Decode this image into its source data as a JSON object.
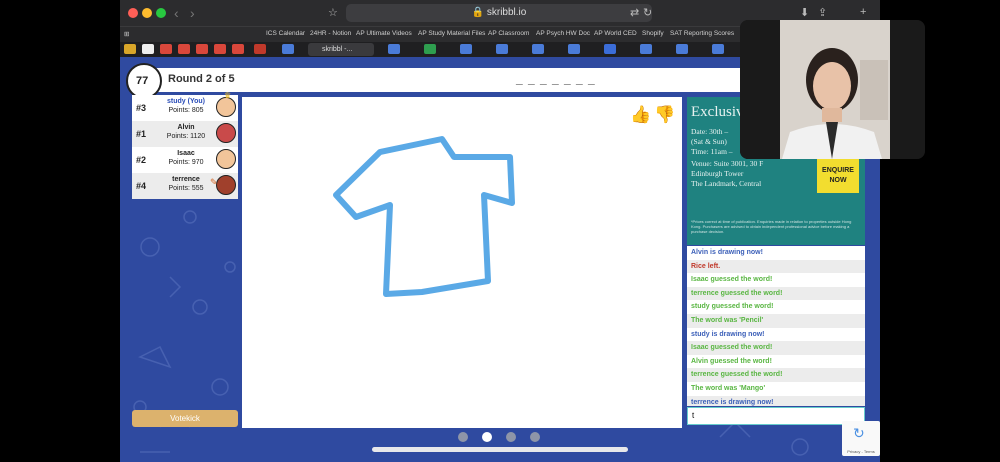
{
  "browser": {
    "url": "skribbl.io",
    "bookmarks": [
      "ICS Calendar",
      "24HR - Notion",
      "AP Ultimate Videos",
      "AP Study Material Files",
      "AP Classroom",
      "AP Psych HW Doc",
      "AP World CED",
      "Shopify",
      "SAT Reporting Scores"
    ],
    "active_tab": "skribbl -..."
  },
  "game": {
    "timer": "77",
    "round_label": "Round 2 of 5",
    "word_hint": "_ _ _ _ _ _ _",
    "votekick_label": "Votekick",
    "chat_input_value": "t"
  },
  "players": [
    {
      "rank": "#3",
      "name": "study (You)",
      "points": "Points: 805"
    },
    {
      "rank": "#1",
      "name": "Alvin",
      "points": "Points: 1120"
    },
    {
      "rank": "#2",
      "name": "Isaac",
      "points": "Points: 970"
    },
    {
      "rank": "#4",
      "name": "terrence",
      "points": "Points: 555"
    }
  ],
  "ad": {
    "title": "Exclusiv",
    "lines": [
      "Date: 30th –",
      "(Sat & Sun)",
      "Time: 11am –",
      "Venue: Suite 3001, 30 F",
      "Edinburgh Tower",
      "The Landmark, Central"
    ],
    "button": "ENQUIRE NOW",
    "fine_print": "*Prices correct at time of publication. Enquiries made in relation to properties outside Hong Kong. Purchasers are advised to obtain independent professional advice before making a purchase decision."
  },
  "chat": [
    {
      "text": "Alvin is drawing now!",
      "color": "#3b5fb8"
    },
    {
      "text": "Rice left.",
      "color": "#c0392b"
    },
    {
      "text": "Isaac guessed the word!",
      "color": "#59b642"
    },
    {
      "text": "terrence guessed the word!",
      "color": "#59b642"
    },
    {
      "text": "study guessed the word!",
      "color": "#59b642"
    },
    {
      "text": "The word was 'Pencil'",
      "color": "#59b642"
    },
    {
      "text": "study is drawing now!",
      "color": "#3b5fb8"
    },
    {
      "text": "Isaac guessed the word!",
      "color": "#59b642"
    },
    {
      "text": "Alvin guessed the word!",
      "color": "#59b642"
    },
    {
      "text": "terrence guessed the word!",
      "color": "#59b642"
    },
    {
      "text": "The word was 'Mango'",
      "color": "#59b642"
    },
    {
      "text": "terrence is drawing now!",
      "color": "#3b5fb8"
    }
  ],
  "recaptcha_label": "Privacy - Terms",
  "colors": {
    "site_bg": "#2f4aa0",
    "drawing_stroke": "#5aa9e6",
    "votekick": "#dcb26d"
  }
}
